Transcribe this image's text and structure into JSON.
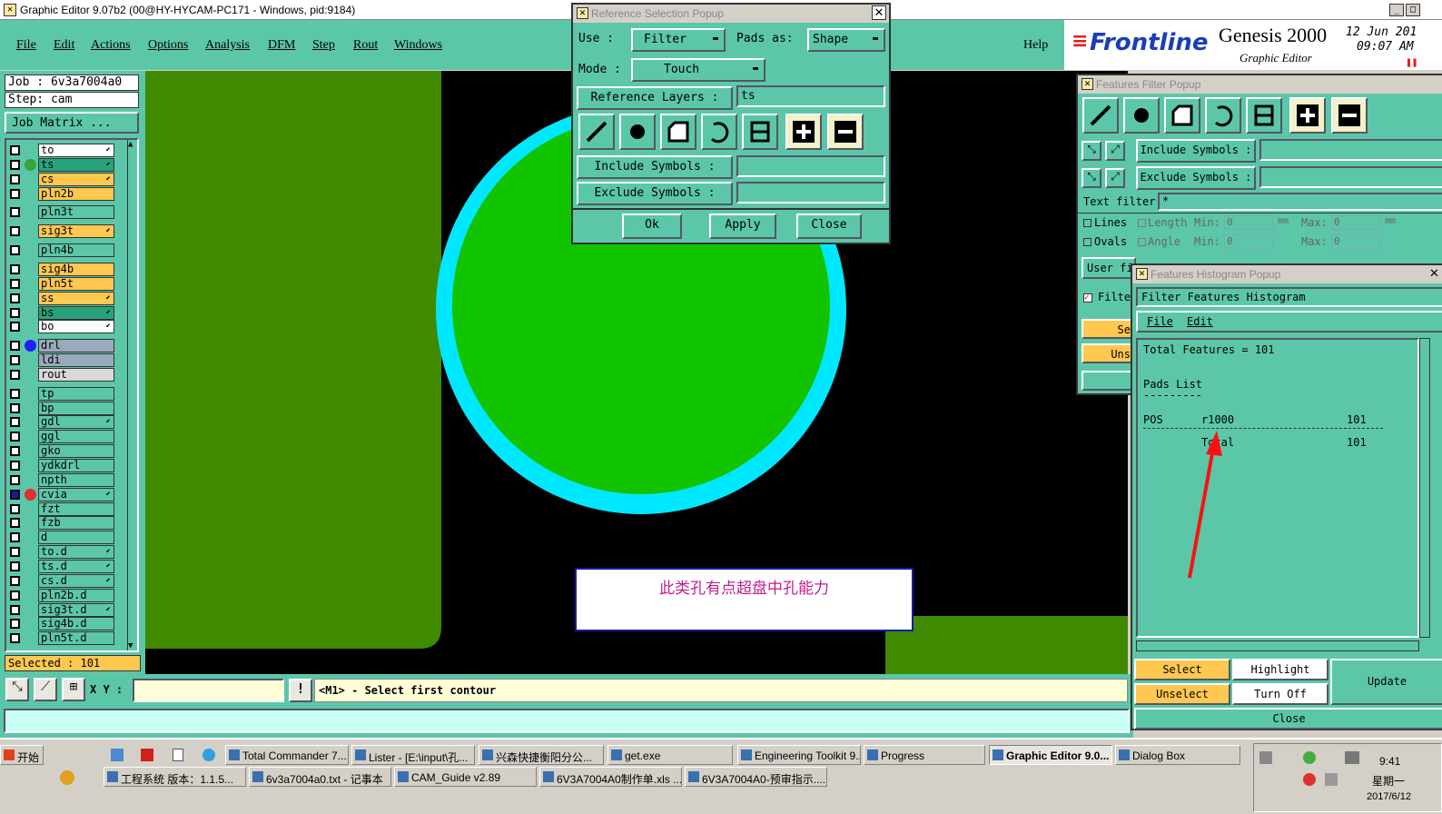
{
  "window": {
    "title": "Graphic Editor 9.07b2 (00@HY-HYCAM-PC171 - Windows, pid:9184)"
  },
  "menu": {
    "items": [
      "File",
      "Edit",
      "Actions",
      "Options",
      "Analysis",
      "DFM",
      "Step",
      "Rout",
      "Windows"
    ],
    "help": "Help"
  },
  "brand": {
    "logo": "Frontline",
    "product": "Genesis 2000",
    "subtitle": "Graphic Editor",
    "date": "12 Jun 201",
    "time": "09:07 AM"
  },
  "job": {
    "job": "Job : 6v3a7004a0",
    "step": "Step: cam",
    "matrix": "Job Matrix ...",
    "selected": "Selected : 101"
  },
  "layers": [
    {
      "name": "to",
      "color": "#ffffff",
      "arrow": true,
      "dot": ""
    },
    {
      "name": "ts",
      "color": "#27a37c",
      "arrow": true,
      "dot": "#3aa33a"
    },
    {
      "name": "cs",
      "color": "#ffc850",
      "arrow": true,
      "dot": ""
    },
    {
      "name": "pln2b",
      "color": "#ffc850",
      "arrow": false,
      "dot": ""
    },
    {
      "name": "pln3t",
      "color": "#5cc7a8",
      "arrow": false,
      "dot": ""
    },
    {
      "name": "sig3t",
      "color": "#ffc850",
      "arrow": true,
      "dot": ""
    },
    {
      "name": "pln4b",
      "color": "#5cc7a8",
      "arrow": false,
      "dot": ""
    },
    {
      "name": "sig4b",
      "color": "#ffc850",
      "arrow": false,
      "dot": ""
    },
    {
      "name": "pln5t",
      "color": "#ffc850",
      "arrow": false,
      "dot": ""
    },
    {
      "name": "ss",
      "color": "#ffc850",
      "arrow": true,
      "dot": ""
    },
    {
      "name": "bs",
      "color": "#27a37c",
      "arrow": true,
      "dot": ""
    },
    {
      "name": "bo",
      "color": "#ffffff",
      "arrow": true,
      "dot": ""
    },
    {
      "name": "drl",
      "color": "#9ab",
      "arrow": false,
      "dot": "#2020ff"
    },
    {
      "name": "ldi",
      "color": "#9ab",
      "arrow": false,
      "dot": ""
    },
    {
      "name": "rout",
      "color": "#d8d8d8",
      "arrow": false,
      "dot": ""
    },
    {
      "name": "tp",
      "color": "#5cc7a8",
      "arrow": false,
      "dot": ""
    },
    {
      "name": "bp",
      "color": "#5cc7a8",
      "arrow": false,
      "dot": ""
    },
    {
      "name": "gdl",
      "color": "#5cc7a8",
      "arrow": true,
      "dot": ""
    },
    {
      "name": "ggl",
      "color": "#5cc7a8",
      "arrow": false,
      "dot": ""
    },
    {
      "name": "gko",
      "color": "#5cc7a8",
      "arrow": false,
      "dot": ""
    },
    {
      "name": "ydkdrl",
      "color": "#5cc7a8",
      "arrow": false,
      "dot": ""
    },
    {
      "name": "npth",
      "color": "#5cc7a8",
      "arrow": false,
      "dot": ""
    },
    {
      "name": "cvia",
      "color": "#5cc7a8",
      "arrow": true,
      "dot": "#e03030"
    },
    {
      "name": "fzt",
      "color": "#5cc7a8",
      "arrow": false,
      "dot": ""
    },
    {
      "name": "fzb",
      "color": "#5cc7a8",
      "arrow": false,
      "dot": ""
    },
    {
      "name": "d",
      "color": "#5cc7a8",
      "arrow": false,
      "dot": ""
    },
    {
      "name": "to.d",
      "color": "#5cc7a8",
      "arrow": true,
      "dot": ""
    },
    {
      "name": "ts.d",
      "color": "#5cc7a8",
      "arrow": true,
      "dot": ""
    },
    {
      "name": "cs.d",
      "color": "#5cc7a8",
      "arrow": true,
      "dot": ""
    },
    {
      "name": "pln2b.d",
      "color": "#5cc7a8",
      "arrow": false,
      "dot": ""
    },
    {
      "name": "sig3t.d",
      "color": "#5cc7a8",
      "arrow": true,
      "dot": ""
    },
    {
      "name": "sig4b.d",
      "color": "#5cc7a8",
      "arrow": false,
      "dot": ""
    },
    {
      "name": "pln5t.d",
      "color": "#5cc7a8",
      "arrow": false,
      "dot": ""
    }
  ],
  "bottom": {
    "xy_label": "X Y :",
    "status": "<M1> - Select first contour"
  },
  "annotation": {
    "text": "此类孔有点超盘中孔能力"
  },
  "ref_popup": {
    "title": "Reference Selection Popup",
    "use_label": "Use :",
    "use_value": "Filter",
    "pads_label": "Pads as:",
    "pads_value": "Shape",
    "mode_label": "Mode :",
    "mode_value": "Touch",
    "layers_label": "Reference Layers :",
    "layers_value": "ts",
    "include_label": "Include Symbols :",
    "exclude_label": "Exclude Symbols :",
    "ok": "Ok",
    "apply": "Apply",
    "close": "Close"
  },
  "filter_popup": {
    "title": "Features Filter Popup",
    "include_label": "Include Symbols :",
    "exclude_label": "Exclude Symbols :",
    "text_filter_label": "Text filter",
    "text_filter_value": "*",
    "lines": "Lines",
    "ovals": "Ovals",
    "length": "Length",
    "angle": "Angle",
    "min": "Min:",
    "max": "Max:",
    "min_value": "0",
    "max_value": "0",
    "unit": "mm",
    "user_fi": "User fi",
    "filte": "Filte",
    "se": "Se",
    "uns": "Uns"
  },
  "hist_popup": {
    "title": "Features Histogram Popup",
    "header": "Filter Features Histogram",
    "menu_file": "File",
    "menu_edit": "Edit",
    "total": "Total Features = 101",
    "pads_list": "Pads List",
    "pads_underline": "---------",
    "row_pos": "POS",
    "row_sym": "r1000",
    "row_count": "101",
    "total_label": "Total",
    "total_count": "101",
    "select": "Select",
    "highlight": "Highlight",
    "update": "Update",
    "unselect": "Unselect",
    "turn_off": "Turn Off",
    "close": "Close"
  },
  "taskbar": {
    "start": "开始",
    "row1": [
      "Total Commander 7....",
      "Lister - [E:\\input\\孔...",
      "兴森快捷衡阳分公...",
      "get.exe",
      "Engineering Toolkit 9...",
      "Progress",
      "Graphic Editor 9.0...",
      "Dialog Box"
    ],
    "row2": [
      "工程系统  版本：1.1.5...",
      "6v3a7004a0.txt - 记事本",
      "CAM_Guide v2.89",
      "6V3A7004A0制作单.xls ...",
      "6V3A7004A0-预审指示...."
    ],
    "clock": "9:41",
    "weekday": "星期一",
    "date": "2017/6/12"
  }
}
